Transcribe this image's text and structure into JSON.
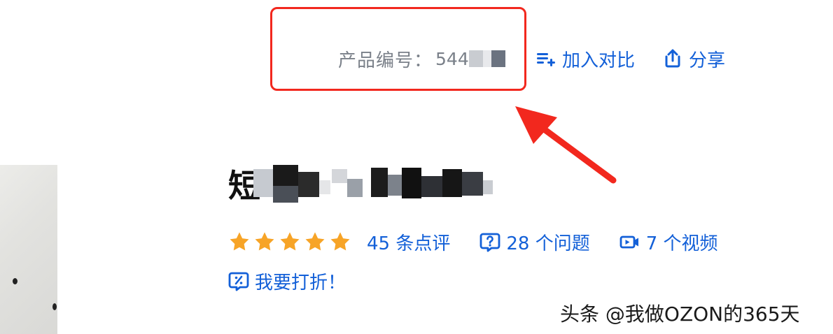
{
  "product": {
    "sku_label": "产品编号：",
    "sku_value_visible": "544",
    "title_visible": "短"
  },
  "actions": {
    "compare_label": "加入对比",
    "share_label": "分享"
  },
  "stats": {
    "rating_stars": 5,
    "reviews_text": "45 条点评",
    "questions_text": "28 个问题",
    "videos_text": "7 个视频"
  },
  "bargain": {
    "label": "我要打折！"
  },
  "watermark": {
    "text": "头条 @我做OZON的365天"
  },
  "colors": {
    "link_blue": "#1360d8",
    "star_orange": "#f7a427",
    "highlight_red": "#f2281e",
    "muted_gray": "#7a8089"
  },
  "icons": {
    "compare": "compare-list-plus-icon",
    "share": "share-upload-icon",
    "questions": "question-bubble-icon",
    "videos": "video-camera-icon",
    "bargain": "discount-bubble-icon",
    "star": "star-icon"
  }
}
